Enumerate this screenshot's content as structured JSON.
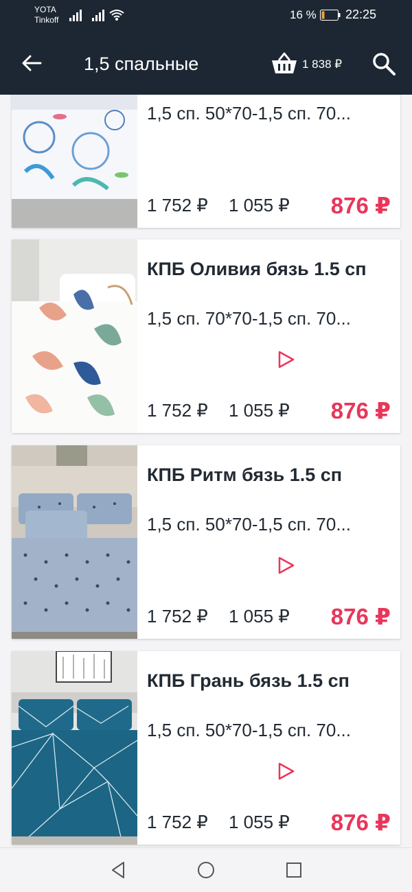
{
  "status_bar": {
    "carrier1": "YOTA",
    "carrier2": "Tinkoff",
    "battery": "16 %",
    "time": "22:25"
  },
  "app_bar": {
    "title": "1,5 спальные",
    "cart_total": "1 838 ₽"
  },
  "colors": {
    "bar_bg": "#1d2733",
    "accent": "#e8365a",
    "battery_low": "#f2a13a"
  },
  "products": [
    {
      "name": "",
      "sizes": "1,5 сп. 50*70-1,5 сп. 70...",
      "price_old1": "1 752 ₽",
      "price_old2": "1 055 ₽",
      "price": "876 ₽",
      "has_play": false
    },
    {
      "name": "КПБ Оливия бязь 1.5 сп",
      "sizes": "1,5 сп. 70*70-1,5 сп. 70...",
      "price_old1": "1 752 ₽",
      "price_old2": "1 055 ₽",
      "price": "876 ₽",
      "has_play": true
    },
    {
      "name": "КПБ Ритм бязь 1.5 сп",
      "sizes": "1,5 сп. 50*70-1,5 сп. 70...",
      "price_old1": "1 752 ₽",
      "price_old2": "1 055 ₽",
      "price": "876 ₽",
      "has_play": true
    },
    {
      "name": "КПБ Грань бязь 1.5 сп",
      "sizes": "1,5 сп. 50*70-1,5 сп. 70...",
      "price_old1": "1 752 ₽",
      "price_old2": "1 055 ₽",
      "price": "876 ₽",
      "has_play": true
    }
  ]
}
